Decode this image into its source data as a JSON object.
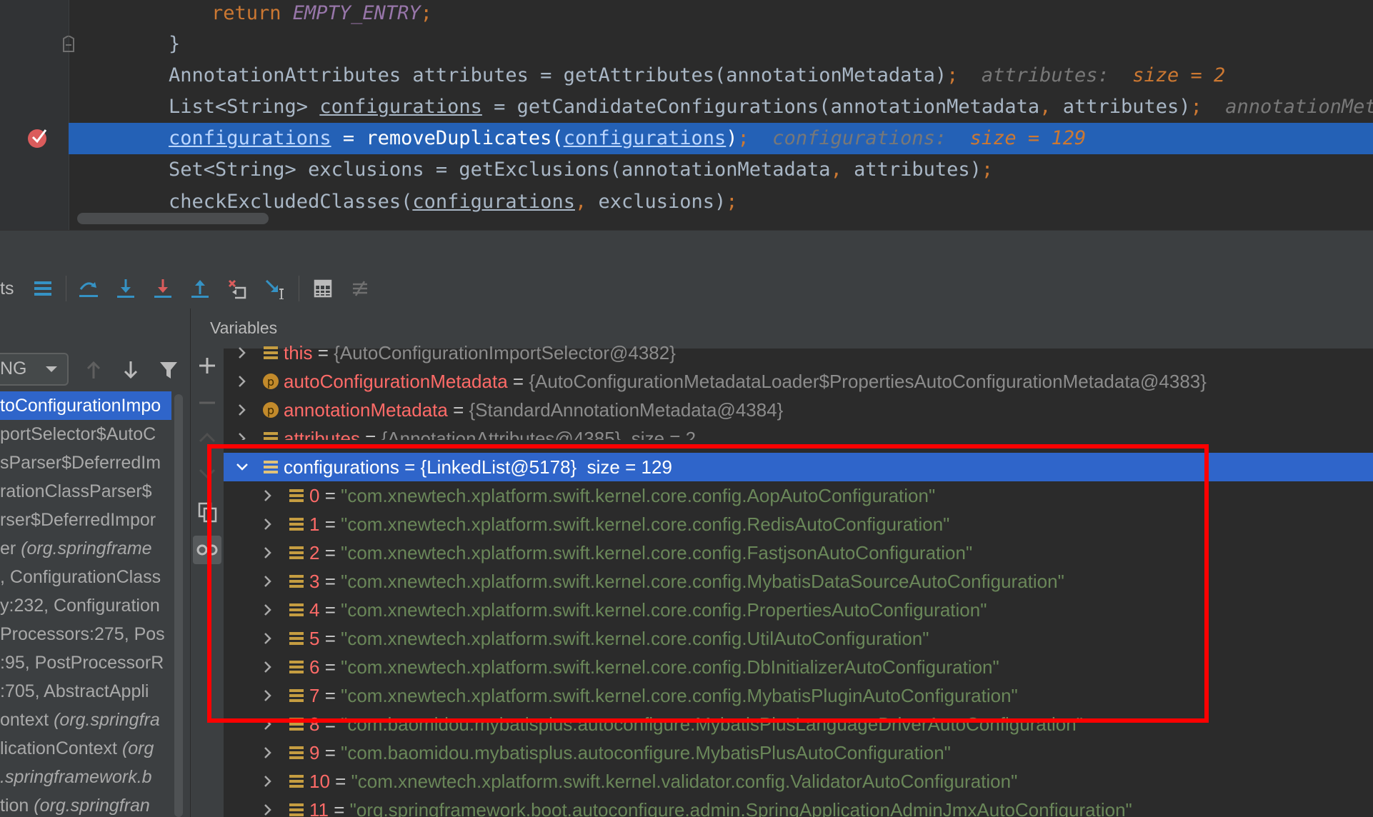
{
  "editor": {
    "lines": [
      {
        "parts": [
          {
            "t": "return ",
            "c": "c-kw"
          },
          {
            "t": "EMPTY_ENTRY",
            "c": "c-const"
          },
          {
            "t": ";",
            "c": "c-kw"
          }
        ],
        "indent": 60
      },
      {
        "parts": [
          {
            "t": "}",
            "c": "c-plain"
          }
        ],
        "indent": 0
      },
      {
        "parts": [
          {
            "t": "AnnotationAttributes attributes = getAttributes(annotationMetadata)",
            "c": "c-plain"
          },
          {
            "t": ";",
            "c": "c-kw"
          },
          {
            "t": "  attributes:  ",
            "c": "c-hint"
          },
          {
            "t": "size = 2",
            "c": "c-hintv"
          }
        ],
        "indent": 0
      },
      {
        "parts": [
          {
            "t": "List<String> ",
            "c": "c-plain"
          },
          {
            "t": "configurations",
            "c": "c-ul"
          },
          {
            "t": " = getCandidateConfigurations(annotationMetadata",
            "c": "c-plain"
          },
          {
            "t": ",",
            "c": "c-kw"
          },
          {
            "t": " attributes)",
            "c": "c-plain"
          },
          {
            "t": ";",
            "c": "c-kw"
          },
          {
            "t": "  annotationMeta",
            "c": "c-hint"
          }
        ],
        "indent": 0
      },
      {
        "parts": [
          {
            "t": "configurations",
            "c": "c-ul"
          },
          {
            "t": " = removeDuplicates(",
            "c": "c-plain"
          },
          {
            "t": "configurations",
            "c": "c-ul"
          },
          {
            "t": ")",
            "c": "c-plain"
          },
          {
            "t": ";",
            "c": "c-kw"
          },
          {
            "t": "  configurations:  ",
            "c": "c-hint"
          },
          {
            "t": "size = 129",
            "c": "c-hintv"
          }
        ],
        "indent": 0,
        "highlight": true
      },
      {
        "parts": [
          {
            "t": "Set<String> exclusions = getExclusions(annotationMetadata",
            "c": "c-plain"
          },
          {
            "t": ",",
            "c": "c-kw"
          },
          {
            "t": " attributes)",
            "c": "c-plain"
          },
          {
            "t": ";",
            "c": "c-kw"
          }
        ],
        "indent": 0
      },
      {
        "parts": [
          {
            "t": "checkExcludedClasses(",
            "c": "c-plain"
          },
          {
            "t": "configurations",
            "c": "c-ul"
          },
          {
            "t": ",",
            "c": "c-kw"
          },
          {
            "t": " exclusions)",
            "c": "c-plain"
          },
          {
            "t": ";",
            "c": "c-kw"
          }
        ],
        "indent": 0
      }
    ]
  },
  "toolbar": {
    "left_text": "ts"
  },
  "frames": {
    "thread_select": "NG",
    "rows": [
      {
        "text": "toConfigurationImpo",
        "sel": true
      },
      {
        "text": "portSelector$AutoC"
      },
      {
        "text": "sParser$DeferredIm"
      },
      {
        "text": "rationClassParser$"
      },
      {
        "text": "rser$DeferredImpor"
      },
      {
        "text": "er ",
        "italic": "(org.springframe"
      },
      {
        "text": ", ConfigurationClass"
      },
      {
        "text": "y:232, Configuration"
      },
      {
        "text": "Processors:275, Pos"
      },
      {
        "text": ":95, PostProcessorR"
      },
      {
        "text": ":705, AbstractAppli"
      },
      {
        "text": "ontext ",
        "italic": "(org.springfra"
      },
      {
        "text": "licationContext ",
        "italic": "(org"
      },
      {
        "text": "",
        "italic": ".springframework.b"
      },
      {
        "text": "tion ",
        "italic": "(org.springfran"
      }
    ]
  },
  "variables": {
    "header": "Variables",
    "rows": [
      {
        "kind": "field",
        "name": "this",
        "eq": " = ",
        "val": "{AutoConfigurationImportSelector@4382}",
        "indent": 0
      },
      {
        "kind": "param",
        "name": "autoConfigurationMetadata",
        "eq": " = ",
        "val": "{AutoConfigurationMetadataLoader$PropertiesAutoConfigurationMetadata@4383}",
        "indent": 0
      },
      {
        "kind": "param",
        "name": "annotationMetadata",
        "eq": " = ",
        "val": "{StandardAnnotationMetadata@4384}",
        "indent": 0
      },
      {
        "kind": "field",
        "name": "attributes",
        "eq": " = ",
        "val": "{AnnotationAttributes@4385}  size = 2",
        "indent": 0,
        "partial": true
      },
      {
        "kind": "field",
        "name": "configurations",
        "eq": " = ",
        "val": "{LinkedList@5178}  size = 129",
        "indent": 0,
        "sel": true,
        "expanded": true
      },
      {
        "kind": "item",
        "name": "0",
        "eq": " = ",
        "str": "\"com.xnewtech.xplatform.swift.kernel.core.config.AopAutoConfiguration\"",
        "indent": 1
      },
      {
        "kind": "item",
        "name": "1",
        "eq": " = ",
        "str": "\"com.xnewtech.xplatform.swift.kernel.core.config.RedisAutoConfiguration\"",
        "indent": 1
      },
      {
        "kind": "item",
        "name": "2",
        "eq": " = ",
        "str": "\"com.xnewtech.xplatform.swift.kernel.core.config.FastjsonAutoConfiguration\"",
        "indent": 1
      },
      {
        "kind": "item",
        "name": "3",
        "eq": " = ",
        "str": "\"com.xnewtech.xplatform.swift.kernel.core.config.MybatisDataSourceAutoConfiguration\"",
        "indent": 1
      },
      {
        "kind": "item",
        "name": "4",
        "eq": " = ",
        "str": "\"com.xnewtech.xplatform.swift.kernel.core.config.PropertiesAutoConfiguration\"",
        "indent": 1
      },
      {
        "kind": "item",
        "name": "5",
        "eq": " = ",
        "str": "\"com.xnewtech.xplatform.swift.kernel.core.config.UtilAutoConfiguration\"",
        "indent": 1
      },
      {
        "kind": "item",
        "name": "6",
        "eq": " = ",
        "str": "\"com.xnewtech.xplatform.swift.kernel.core.config.DbInitializerAutoConfiguration\"",
        "indent": 1
      },
      {
        "kind": "item",
        "name": "7",
        "eq": " = ",
        "str": "\"com.xnewtech.xplatform.swift.kernel.core.config.MybatisPluginAutoConfiguration\"",
        "indent": 1
      },
      {
        "kind": "item",
        "name": "8",
        "eq": " = ",
        "str": "\"com.baomidou.mybatisplus.autoconfigure.MybatisPlusLanguageDriverAutoConfiguration\"",
        "indent": 1
      },
      {
        "kind": "item",
        "name": "9",
        "eq": " = ",
        "str": "\"com.baomidou.mybatisplus.autoconfigure.MybatisPlusAutoConfiguration\"",
        "indent": 1
      },
      {
        "kind": "item",
        "name": "10",
        "eq": " = ",
        "str": "\"com.xnewtech.xplatform.swift.kernel.validator.config.ValidatorAutoConfiguration\"",
        "indent": 1
      },
      {
        "kind": "item",
        "name": "11",
        "eq": " = ",
        "str": "\"org.springframework.boot.autoconfigure.admin.SpringApplicationAdminJmxAutoConfiguration\"",
        "indent": 1
      }
    ]
  },
  "colors": {
    "selection": "#2f65ca",
    "highlight_line": "#2461b6",
    "annotation_box": "#ff0000",
    "string_green": "#6a8759",
    "name_red": "#ff6b68"
  }
}
